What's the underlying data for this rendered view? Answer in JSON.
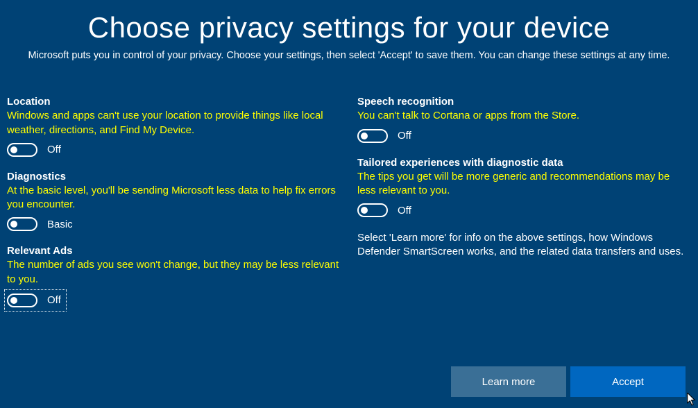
{
  "header": {
    "title": "Choose privacy settings for your device",
    "subtitle": "Microsoft puts you in control of your privacy. Choose your settings, then select 'Accept' to save them. You can change these settings at any time."
  },
  "settings": {
    "location": {
      "title": "Location",
      "desc": "Windows and apps can't use your location to provide things like local weather, directions, and Find My Device.",
      "state_label": "Off"
    },
    "diagnostics": {
      "title": "Diagnostics",
      "desc": "At the basic level, you'll be sending Microsoft less data to help fix errors you encounter.",
      "state_label": "Basic"
    },
    "relevant_ads": {
      "title": "Relevant Ads",
      "desc": "The number of ads you see won't change, but they may be less relevant to you.",
      "state_label": "Off"
    },
    "speech": {
      "title": "Speech recognition",
      "desc": "You can't talk to Cortana or apps from the Store.",
      "state_label": "Off"
    },
    "tailored": {
      "title": "Tailored experiences with diagnostic data",
      "desc": "The tips you get will be more generic and recommendations may be less relevant to you.",
      "state_label": "Off"
    }
  },
  "info_text": "Select 'Learn more' for info on the above settings, how Windows Defender SmartScreen works, and the related data transfers and uses.",
  "buttons": {
    "learn_more": "Learn more",
    "accept": "Accept"
  }
}
